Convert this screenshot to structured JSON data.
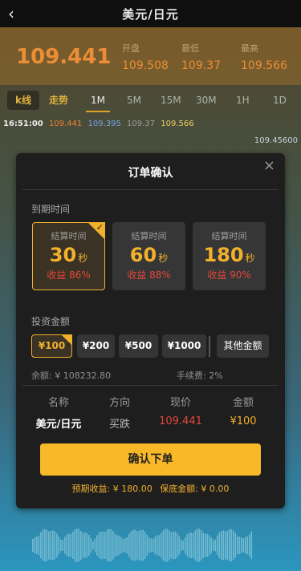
{
  "header": {
    "title": "美元/日元",
    "back_icon": "chevron-left-icon"
  },
  "quote": {
    "price": "109.441",
    "open_label": "开盘",
    "open_value": "109.508",
    "low_label": "最低",
    "low_value": "109.37",
    "high_label": "最高",
    "high_value": "109.566"
  },
  "tabs": {
    "kline": "k线",
    "trend": "走势",
    "periods": [
      "1M",
      "5M",
      "15M",
      "30M",
      "1H",
      "1D"
    ],
    "selected": "1M"
  },
  "ticker": {
    "time": "16:51:00",
    "open": "109.441",
    "low": "109.395",
    "prev": "109.37",
    "high": "109.566"
  },
  "chart": {
    "axis_top": "109.45600"
  },
  "modal": {
    "title": "订单确认",
    "close_icon": "close-icon",
    "expiry_label": "到期时间",
    "expiry_options": [
      {
        "label": "结算时间",
        "duration": "30",
        "unit": "秒",
        "yield": "收益 86%",
        "selected": true
      },
      {
        "label": "结算时间",
        "duration": "60",
        "unit": "秒",
        "yield": "收益 88%",
        "selected": false
      },
      {
        "label": "结算时间",
        "duration": "180",
        "unit": "秒",
        "yield": "收益 90%",
        "selected": false
      }
    ],
    "amount_label": "投资金额",
    "amounts": [
      "¥100",
      "¥200",
      "¥500",
      "¥1000"
    ],
    "selected_amount": "¥100",
    "other_amount": "其他金额",
    "balance": "余额: ¥ 108232.80",
    "fee": "手续费: 2%",
    "table_headers": [
      "名称",
      "方向",
      "现价",
      "金额"
    ],
    "table_values": [
      "美元/日元",
      "买跌",
      "109.441",
      "¥100"
    ],
    "confirm_button": "确认下单",
    "expected_profit": "预期收益: ¥ 180.00",
    "guarantee": "保底金额: ¥ 0.00"
  },
  "colors": {
    "accent": "#f8b828",
    "down": "#e2473b",
    "modal_bg": "#1e1e1e"
  }
}
